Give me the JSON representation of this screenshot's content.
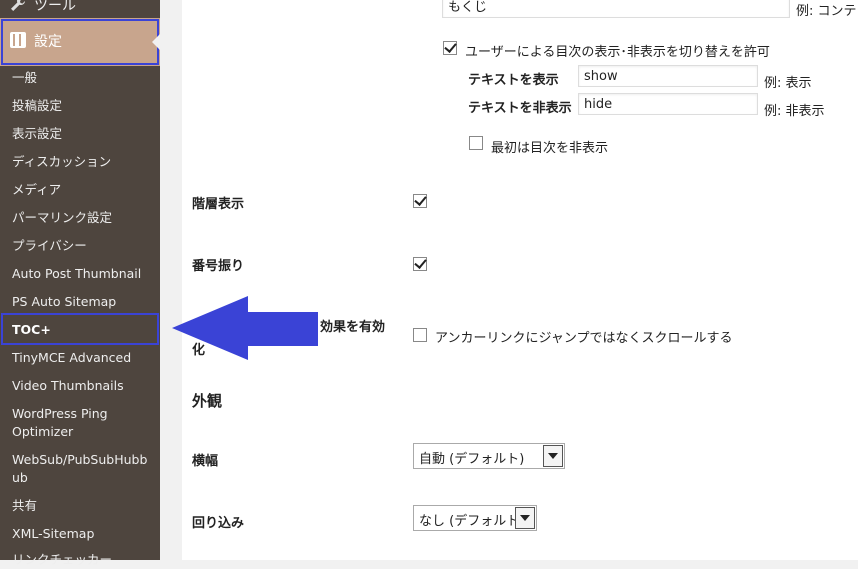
{
  "sidebar": {
    "tools_label": "ツール",
    "settings_label": "設定",
    "sub_items": [
      "一般",
      "投稿設定",
      "表示設定",
      "ディスカッション",
      "メディア",
      "パーマリンク設定",
      "プライバシー",
      "Auto Post Thumbnail",
      "PS Auto Sitemap",
      "TOC+",
      "TinyMCE Advanced",
      "Video Thumbnails",
      "WordPress Ping",
      "Optimizer",
      "WebSub/PubSubHubb",
      "ub",
      "共有",
      "XML-Sitemap",
      "リンクチェッカー"
    ]
  },
  "main": {
    "heading_input_value": "もくじ",
    "heading_example": "例: コンテン",
    "toggle_label": "ユーザーによる目次の表示･非表示を切り替えを許可",
    "show_label": "テキストを表示",
    "show_value": "show",
    "show_example": "例: 表示",
    "hide_label": "テキストを非表示",
    "hide_value": "hide",
    "hide_example": "例: 非表示",
    "initially_hide_label": "最初は目次を非表示",
    "hierarchy_label": "階層表示",
    "numbering_label": "番号振り",
    "smooth_label_line1": "効果を有効",
    "smooth_label_line2": "化",
    "smooth_option_label": "アンカーリンクにジャンプではなくスクロールする",
    "appearance_heading": "外観",
    "width_label": "横幅",
    "width_value": "自動 (デフォルト)",
    "wrap_label": "回り込み",
    "wrap_value": "なし (デフォルト)"
  },
  "colors": {
    "sidebar_bg": "#4e453e",
    "current_bg": "#c8a58d",
    "highlight": "#3a43d6"
  }
}
